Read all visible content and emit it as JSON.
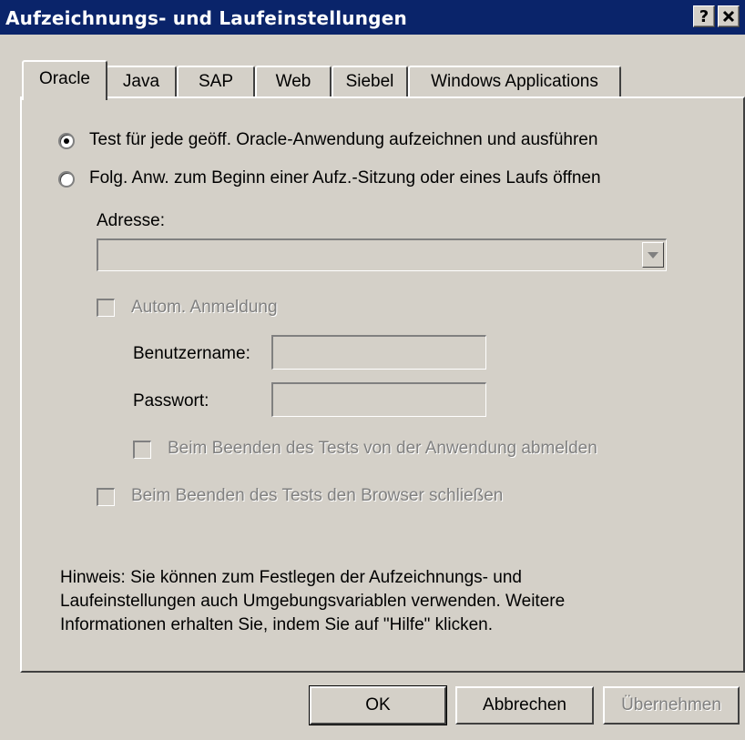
{
  "window": {
    "title": "Aufzeichnungs- und Laufeinstellungen",
    "help_button": "?",
    "close_button": "✕"
  },
  "tabs": [
    {
      "label": "Oracle",
      "active": true
    },
    {
      "label": "Java",
      "active": false
    },
    {
      "label": "SAP",
      "active": false
    },
    {
      "label": "Web",
      "active": false
    },
    {
      "label": "Siebel",
      "active": false
    },
    {
      "label": "Windows Applications",
      "active": false
    }
  ],
  "oracle": {
    "radio_all": {
      "label": "Test für jede geöff. Oracle-Anwendung aufzeichnen und ausführen",
      "checked": true
    },
    "radio_open": {
      "label": "Folg. Anw. zum Beginn einer Aufz.-Sitzung oder eines Laufs öffnen",
      "checked": false
    },
    "address_label": "Adresse:",
    "address_value": "",
    "auto_login": {
      "label": "Autom. Anmeldung",
      "checked": false
    },
    "username_label": "Benutzername:",
    "username_value": "",
    "password_label": "Passwort:",
    "password_value": "",
    "logout_on_end": {
      "label": "Beim Beenden des Tests von der Anwendung abmelden",
      "checked": false
    },
    "close_browser": {
      "label": "Beim Beenden des Tests den Browser schließen",
      "checked": false
    },
    "hint_lines": [
      "Hinweis: Sie können zum Festlegen der Aufzeichnungs- und",
      "Laufeinstellungen auch Umgebungsvariablen verwenden. Weitere",
      "Informationen erhalten Sie, indem Sie auf \"Hilfe\" klicken."
    ]
  },
  "buttons": {
    "ok": "OK",
    "cancel": "Abbrechen",
    "apply": "Übernehmen"
  },
  "colors": {
    "titlebar": "#0a246a",
    "face": "#d4d0c8",
    "disabled_text": "#808080"
  }
}
